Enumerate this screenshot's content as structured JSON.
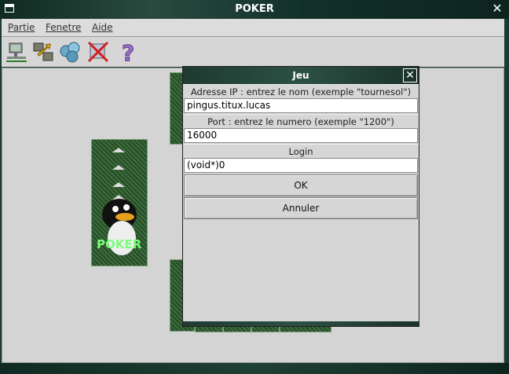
{
  "window": {
    "title": "POKER",
    "close_glyph": "✕"
  },
  "menu": {
    "items": [
      "Partie",
      "Fenetre",
      "Aide"
    ]
  },
  "toolbar": {
    "icons": [
      "network-icon",
      "exchange-icon",
      "players-icon",
      "disconnect-icon",
      "help-icon"
    ],
    "help_glyph": "?"
  },
  "cards": {
    "brand_text": "POKER"
  },
  "dialog": {
    "title": "Jeu",
    "close_glyph": "✕",
    "ip_label": "Adresse IP : entrez le nom (exemple \"tournesol\")",
    "ip_value": "pingus.titux.lucas",
    "port_label": "Port : entrez le numero (exemple \"1200\")",
    "port_value": "16000",
    "login_label": "Login",
    "login_value": "(void*)0",
    "ok_label": "OK",
    "cancel_label": "Annuler"
  }
}
